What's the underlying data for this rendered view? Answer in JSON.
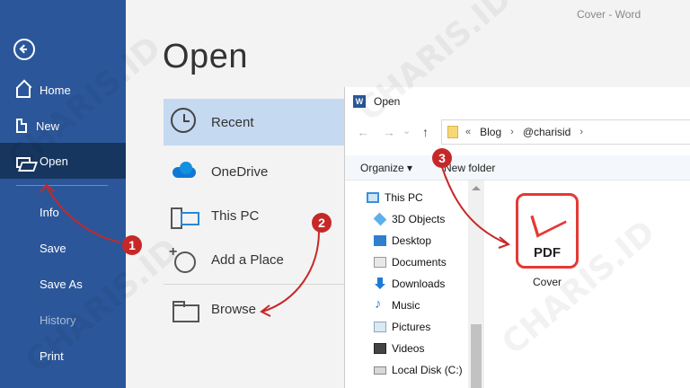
{
  "window": {
    "doc_title": "Cover  -  Word"
  },
  "sidebar": {
    "items": [
      {
        "label": "Home"
      },
      {
        "label": "New"
      },
      {
        "label": "Open"
      },
      {
        "label": "Info"
      },
      {
        "label": "Save"
      },
      {
        "label": "Save As"
      },
      {
        "label": "History"
      },
      {
        "label": "Print"
      }
    ]
  },
  "open_pane": {
    "title": "Open",
    "locations": [
      {
        "label": "Recent"
      },
      {
        "label": "OneDrive"
      },
      {
        "label": "This PC"
      },
      {
        "label": "Add a Place"
      },
      {
        "label": "Browse"
      }
    ]
  },
  "dialog": {
    "title": "Open",
    "title_icon": "W",
    "address": {
      "overflow": "«",
      "parts": [
        "Blog",
        "@charisid"
      ],
      "separator": "›"
    },
    "toolbar": {
      "organize": "Organize ▾",
      "new_folder": "New folder"
    },
    "tree": [
      {
        "label": "This PC",
        "icon": "this-pc-icon"
      },
      {
        "label": "3D Objects",
        "icon": "3d-objects-icon"
      },
      {
        "label": "Desktop",
        "icon": "desktop-icon"
      },
      {
        "label": "Documents",
        "icon": "documents-icon"
      },
      {
        "label": "Downloads",
        "icon": "downloads-icon"
      },
      {
        "label": "Music",
        "icon": "music-icon"
      },
      {
        "label": "Pictures",
        "icon": "pictures-icon"
      },
      {
        "label": "Videos",
        "icon": "videos-icon"
      },
      {
        "label": "Local Disk (C:)",
        "icon": "local-disk-icon"
      }
    ],
    "file": {
      "name": "Cover",
      "type_label": "PDF"
    }
  },
  "annotations": {
    "steps": [
      "1",
      "2",
      "3"
    ],
    "color": "#c62828"
  },
  "watermark": "CHARIS.ID",
  "colors": {
    "sidebar": "#2b579a",
    "sidebar_active": "#17365f",
    "selected_location": "#c5d9f1",
    "pdf": "#e53935"
  }
}
